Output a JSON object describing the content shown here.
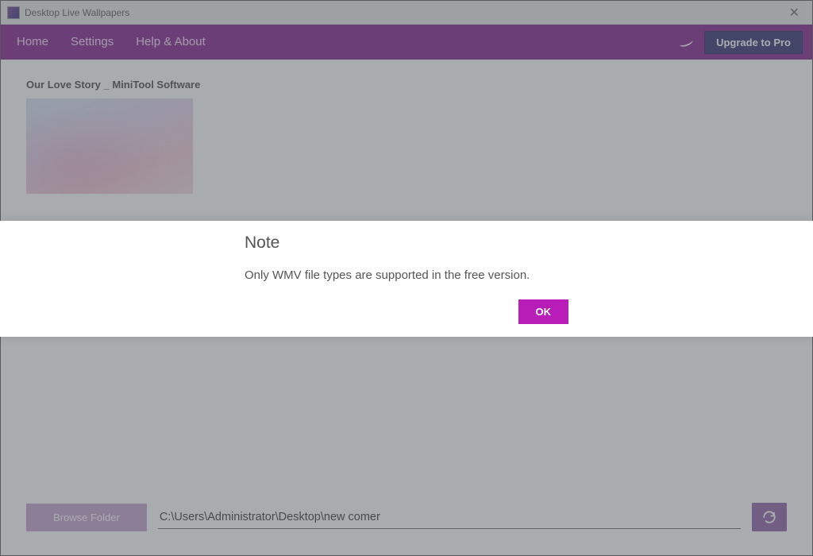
{
  "titlebar": {
    "title": "Desktop Live Wallpapers"
  },
  "nav": {
    "home": "Home",
    "settings": "Settings",
    "help": "Help & About",
    "upgrade": "Upgrade to Pro"
  },
  "content": {
    "item_title": "Our Love Story _ MiniTool Software",
    "thumb_caption": ""
  },
  "bottom": {
    "browse_label": "Browse Folder",
    "path_value": "C:\\Users\\Administrator\\Desktop\\new comer"
  },
  "modal": {
    "title": "Note",
    "message": "Only WMV file types are supported in the free version.",
    "ok_label": "OK"
  }
}
